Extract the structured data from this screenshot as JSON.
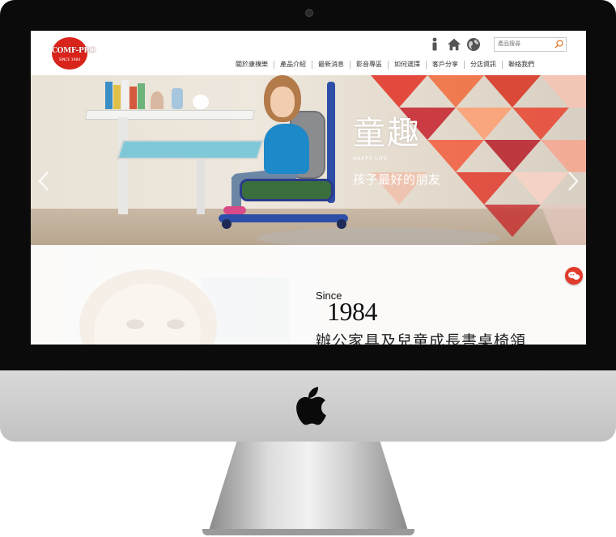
{
  "site": {
    "logo_brand": "COMF-PRO",
    "logo_since": "SINCE 1984"
  },
  "header": {
    "icons": [
      "person-icon",
      "home-icon",
      "globe-icon",
      "search-icon"
    ],
    "search_placeholder": "產品搜尋"
  },
  "nav": {
    "items": [
      "關於康樸樂",
      "產品介紹",
      "最新消息",
      "影音專區",
      "如何選擇",
      "客戶分享",
      "分店資訊",
      "聯絡我們"
    ]
  },
  "hero": {
    "slogan": "童趣",
    "slogan_en": "HAPPY LIFE",
    "subtitle": "孩子最好的朋友",
    "arrows": [
      "chevron-left-icon",
      "chevron-right-icon"
    ]
  },
  "about": {
    "since_label": "Since",
    "year": "1984",
    "tagline": "辦公家具及兒童成長書桌椅領"
  },
  "colors": {
    "brand_red": "#d9241c",
    "nav_text": "#333333",
    "chat_red": "#e23a2c"
  }
}
